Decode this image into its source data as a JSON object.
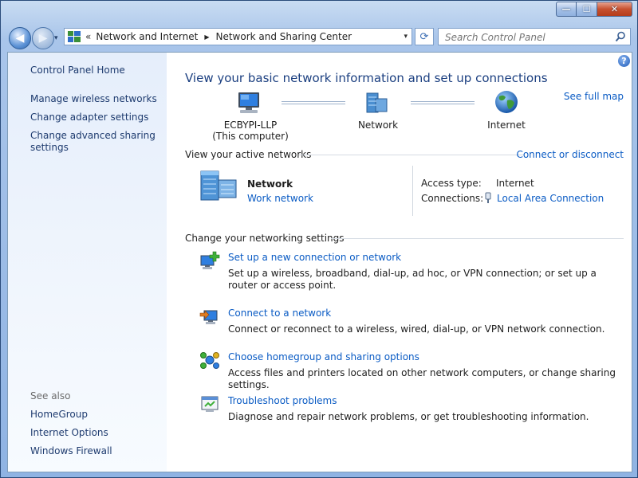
{
  "window": {
    "min_label": "—",
    "max_label": "☐",
    "close_label": "✕"
  },
  "nav": {
    "back_glyph": "◀",
    "forward_glyph": "▶",
    "history_dropdown_glyph": "▾",
    "address_overflow": "«",
    "breadcrumbs": [
      "Network and Internet",
      "Network and Sharing Center"
    ],
    "breadcrumb_separator": "▶",
    "address_dropdown_glyph": "▾",
    "refresh_glyph": "⟳",
    "search_placeholder": "Search Control Panel"
  },
  "sidebar": {
    "home": "Control Panel Home",
    "items": [
      "Manage wireless networks",
      "Change adapter settings",
      "Change advanced sharing settings"
    ],
    "see_also_label": "See also",
    "see_also": [
      "HomeGroup",
      "Internet Options",
      "Windows Firewall"
    ]
  },
  "main": {
    "help_glyph": "?",
    "title": "View your basic network information and set up connections",
    "see_full_map": "See full map",
    "map": {
      "computer_name": "ECBYPI-LLP",
      "computer_sub": "(This computer)",
      "network": "Network",
      "internet": "Internet"
    },
    "active": {
      "header": "View your active networks",
      "connect_link": "Connect or disconnect",
      "network_name": "Network",
      "network_type": "Work network",
      "access_type_label": "Access type:",
      "access_type_value": "Internet",
      "connections_label": "Connections:",
      "connections_value": "Local Area Connection"
    },
    "settings": {
      "header": "Change your networking settings",
      "tasks": [
        {
          "title": "Set up a new connection or network",
          "desc": "Set up a wireless, broadband, dial-up, ad hoc, or VPN connection; or set up a router or access point."
        },
        {
          "title": "Connect to a network",
          "desc": "Connect or reconnect to a wireless, wired, dial-up, or VPN network connection."
        },
        {
          "title": "Choose homegroup and sharing options",
          "desc": "Access files and printers located on other network computers, or change sharing settings."
        },
        {
          "title": "Troubleshoot problems",
          "desc": "Diagnose and repair network problems, or get troubleshooting information."
        }
      ]
    }
  },
  "colors": {
    "link": "#0a5bc4",
    "title": "#1b3f80",
    "sidebar_link": "#1e3b6f"
  }
}
